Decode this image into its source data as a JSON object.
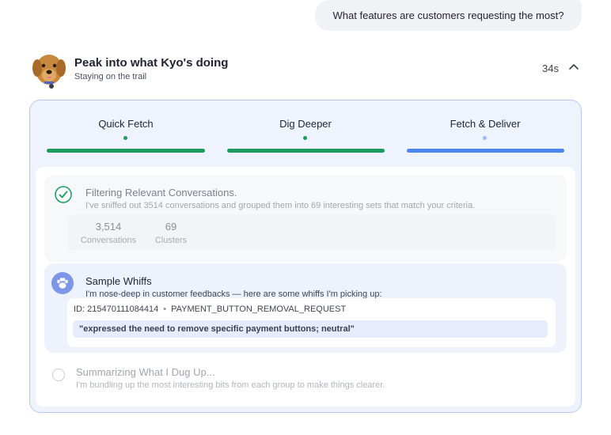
{
  "user_message": "What features are customers requesting the most?",
  "agent": {
    "title": "Peak into what Kyo's doing",
    "subtitle": "Staying on the trail",
    "elapsed": "34s",
    "avatar_icon": "dog-avatar"
  },
  "steps": [
    {
      "label": "Quick Fetch",
      "status": "complete",
      "color": "#1a9a5c"
    },
    {
      "label": "Dig Deeper",
      "status": "complete",
      "color": "#1a9a5c"
    },
    {
      "label": "Fetch & Deliver",
      "status": "active",
      "color": "#4b86ee"
    }
  ],
  "tasks": {
    "filtering": {
      "title": "Filtering Relevant Conversations.",
      "description": "I've sniffed out 3514 conversations and grouped them into 69 interesting sets that match your criteria.",
      "icon": "check-circle-icon",
      "stats": [
        {
          "value": "3,514",
          "label": "Conversations"
        },
        {
          "value": "69",
          "label": "Clusters"
        }
      ]
    },
    "sample": {
      "title": "Sample Whiffs",
      "description": "I'm nose-deep in customer feedbacks — here are some whiffs I'm picking up:",
      "icon": "paw-icon",
      "id_text": "ID: 215470111084414",
      "separator": "•",
      "tag": "PAYMENT_BUTTON_REMOVAL_REQUEST",
      "quote": "\"expressed the need to remove specific payment buttons; neutral\""
    },
    "summarizing": {
      "title": "Summarizing What I Dug Up...",
      "description": "I'm bundling up the most interesting bits from each group to make things clearer.",
      "icon": "pending-circle-icon"
    }
  }
}
